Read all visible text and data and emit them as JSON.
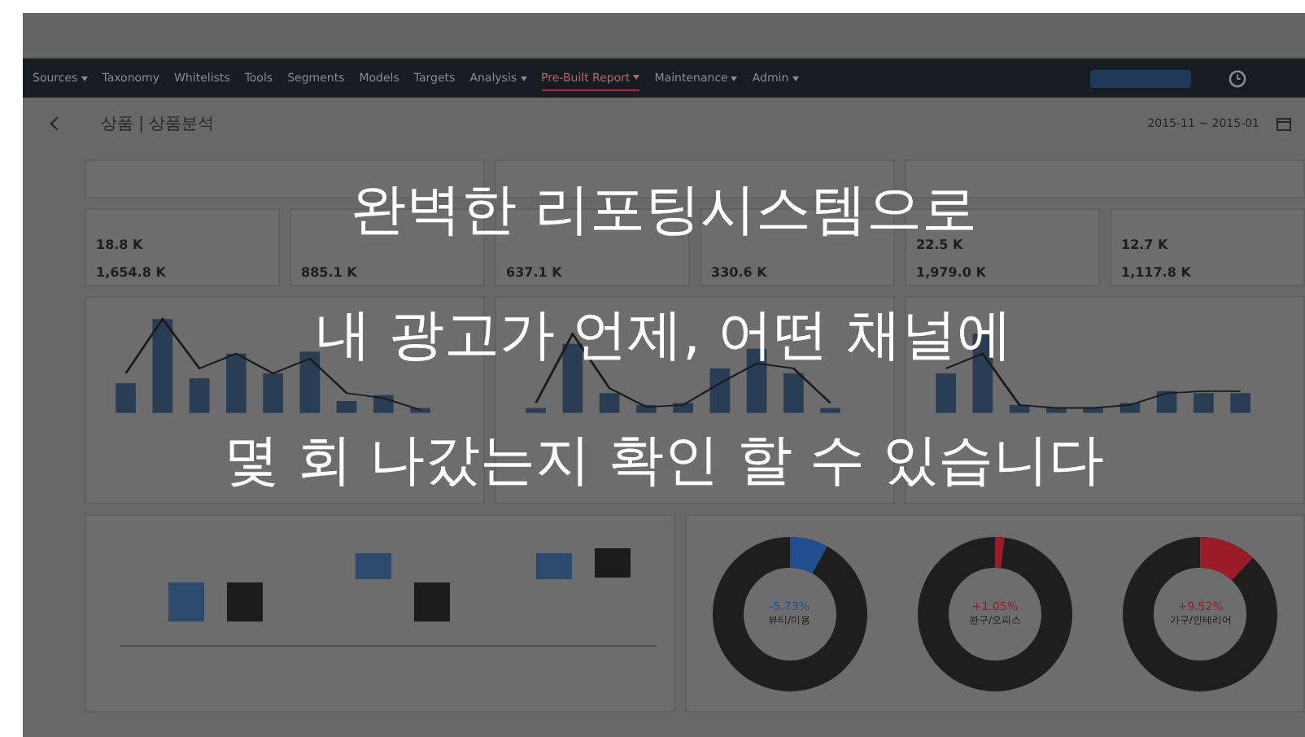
{
  "nav": {
    "items": [
      {
        "label": "Sources",
        "has_menu": true,
        "selected": false
      },
      {
        "label": "Taxonomy",
        "has_menu": false,
        "selected": false
      },
      {
        "label": "Whitelists",
        "has_menu": false,
        "selected": false
      },
      {
        "label": "Tools",
        "has_menu": false,
        "selected": false
      },
      {
        "label": "Segments",
        "has_menu": false,
        "selected": false
      },
      {
        "label": "Models",
        "has_menu": false,
        "selected": false
      },
      {
        "label": "Targets",
        "has_menu": false,
        "selected": false
      },
      {
        "label": "Analysis",
        "has_menu": true,
        "selected": false
      },
      {
        "label": "Pre-Built Report",
        "has_menu": true,
        "selected": true
      },
      {
        "label": "Maintenance",
        "has_menu": true,
        "selected": false
      },
      {
        "label": "Admin",
        "has_menu": true,
        "selected": false
      }
    ]
  },
  "page": {
    "title": "상품 | 상품분석",
    "date_range": "2015-11 ~ 2015-01"
  },
  "kpi_cards": [
    {
      "value_1": "18.8 K",
      "value_2": "1,654.8 K"
    },
    {
      "value_2": "885.1 K"
    },
    {
      "value_2": "637.1 K"
    },
    {
      "value_2": "330.6 K"
    },
    {
      "value_1": "22.5 K",
      "value_2": "1,979.0 K"
    },
    {
      "value_1": "12.7 K",
      "value_2": "1,117.8 K"
    }
  ],
  "donuts": [
    {
      "change": "-5.73%",
      "category": "뷰티/미용",
      "color": "#1f4f8f"
    },
    {
      "change": "+1.05%",
      "category": "완구/오피스",
      "color": "#9a1c28"
    },
    {
      "change": "+9.52%",
      "category": "가구/인테리어",
      "color": "#9a1c28"
    }
  ],
  "headline": {
    "lines": [
      "완벽한 리포팅시스템으로",
      "내 광고가 언제, 어떤 채널에",
      "몇 회 나갔는지  확인 할 수 있습니다"
    ]
  }
}
